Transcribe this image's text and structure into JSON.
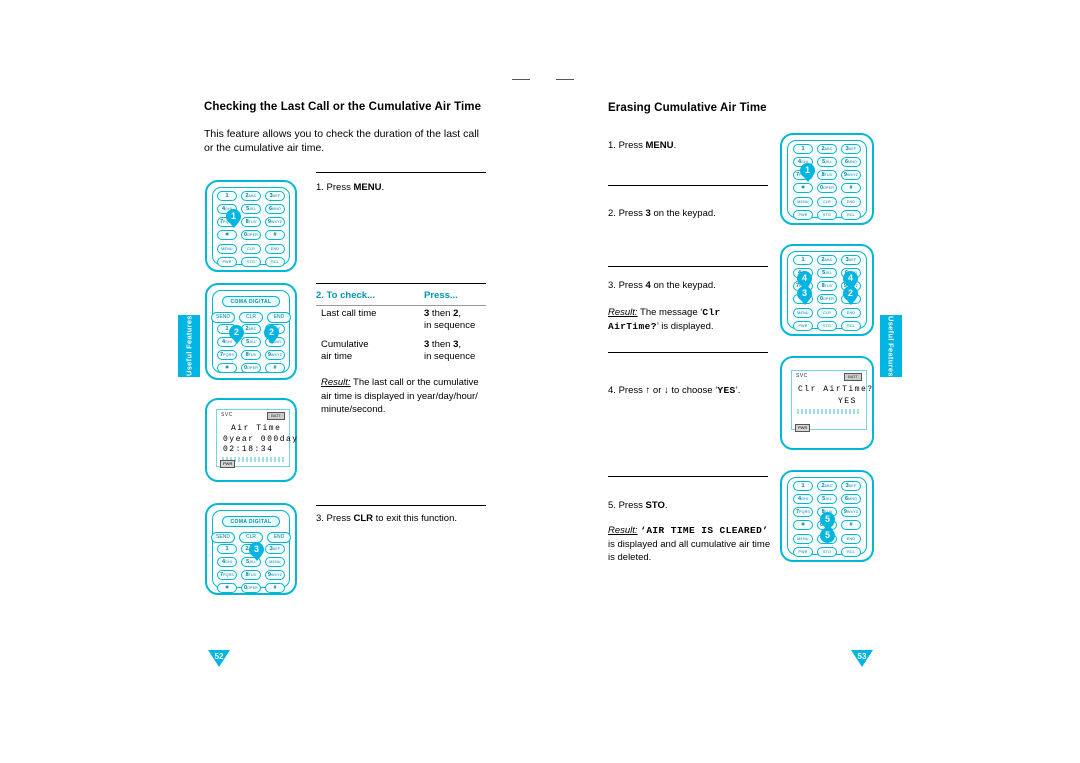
{
  "left_column": {
    "title": "Checking the Last Call or the Cumulative Air Time",
    "intro": "This feature allows you to check the duration of the last call or the cumulative air time.",
    "step1_prefix": "1. Press ",
    "step1_key": "MENU",
    "step1_suffix": ".",
    "step2_label": "2. To check...",
    "step2_press": "Press...",
    "table": [
      {
        "check": "Last call time",
        "press_key": "3",
        "press_mid": " then ",
        "press_key2": "2",
        "press_tail": ",",
        "press_note": "in sequence"
      },
      {
        "check": "Cumulative",
        "check2": "air time",
        "press_key": "3",
        "press_mid": " then ",
        "press_key2": "3",
        "press_tail": ",",
        "press_note": "in sequence"
      }
    ],
    "result_label": "Result:",
    "result_text": "The last call or the cumulative air time is displayed in year/day/hour/ minute/second.",
    "step3_prefix": "3. Press ",
    "step3_key": "CLR",
    "step3_suffix": " to exit this function.",
    "lcd": {
      "svc": "SVC",
      "batt": "BATT",
      "line1": "Air Time",
      "line2": "0year 000day",
      "line3": "02:18:34",
      "tag": "PWR"
    },
    "side_tab": "Useful Features",
    "page_number": "52"
  },
  "right_column": {
    "title": "Erasing Cumulative Air Time",
    "steps": [
      {
        "num": "1.",
        "prefix": "Press ",
        "key": "MENU",
        "suffix": "."
      },
      {
        "num": "2.",
        "prefix": "Press ",
        "key": "3",
        "suffix": " on the keypad."
      },
      {
        "num": "3.",
        "prefix": "Press ",
        "key": "4",
        "suffix": " on the keypad.",
        "result_label": "Result:",
        "result_text": "The message ‘",
        "result_mono": "Clr AirTime?",
        "result_tail": "’ is displayed."
      },
      {
        "num": "4.",
        "prefix": "Press ",
        "key": "↑",
        "mid": " or ",
        "key2": "↓",
        "suffix": " to choose ‘",
        "mono": "YES",
        "tail": "’."
      },
      {
        "num": "5.",
        "prefix": "Press ",
        "key": "STO",
        "suffix": ".",
        "result_label": "Result:",
        "result_mono": "‘AIR TIME IS CLEARED’",
        "result_text": "is displayed and all cumulative air time is deleted."
      }
    ],
    "lcd": {
      "svc": "SVC",
      "batt": "BATT",
      "line1": "Clr AirTime?",
      "line2": "YES",
      "tag": "PWR"
    },
    "side_tab": "Useful Features",
    "page_number": "53"
  },
  "phone": {
    "brand": "COMA DIGITAL",
    "soft_keys": [
      "SEND",
      "CLR",
      "END"
    ],
    "bottom_keys": [
      "PWR",
      "STO",
      "RCL"
    ],
    "keypad": [
      [
        {
          "n": "1",
          "l": ""
        },
        {
          "n": "2",
          "l": "ABC"
        },
        {
          "n": "3",
          "l": "DEF"
        }
      ],
      [
        {
          "n": "4",
          "l": "GHI"
        },
        {
          "n": "5",
          "l": "JKL"
        },
        {
          "n": "6",
          "l": "MNO"
        }
      ],
      [
        {
          "n": "7",
          "l": "PQRS"
        },
        {
          "n": "8",
          "l": "TUV"
        },
        {
          "n": "9",
          "l": "WXYZ"
        }
      ],
      [
        {
          "n": "✲",
          "l": "✽"
        },
        {
          "n": "0",
          "l": "OPER"
        },
        {
          "n": "#",
          "l": "↓"
        }
      ]
    ],
    "menu_key": "MENU",
    "colors": {
      "accent": "#00b5e2",
      "line": "#00b8d4"
    }
  },
  "bubbles": {
    "b1": "1",
    "b2": "2",
    "b3": "3",
    "b4": "4",
    "b5": "5"
  }
}
